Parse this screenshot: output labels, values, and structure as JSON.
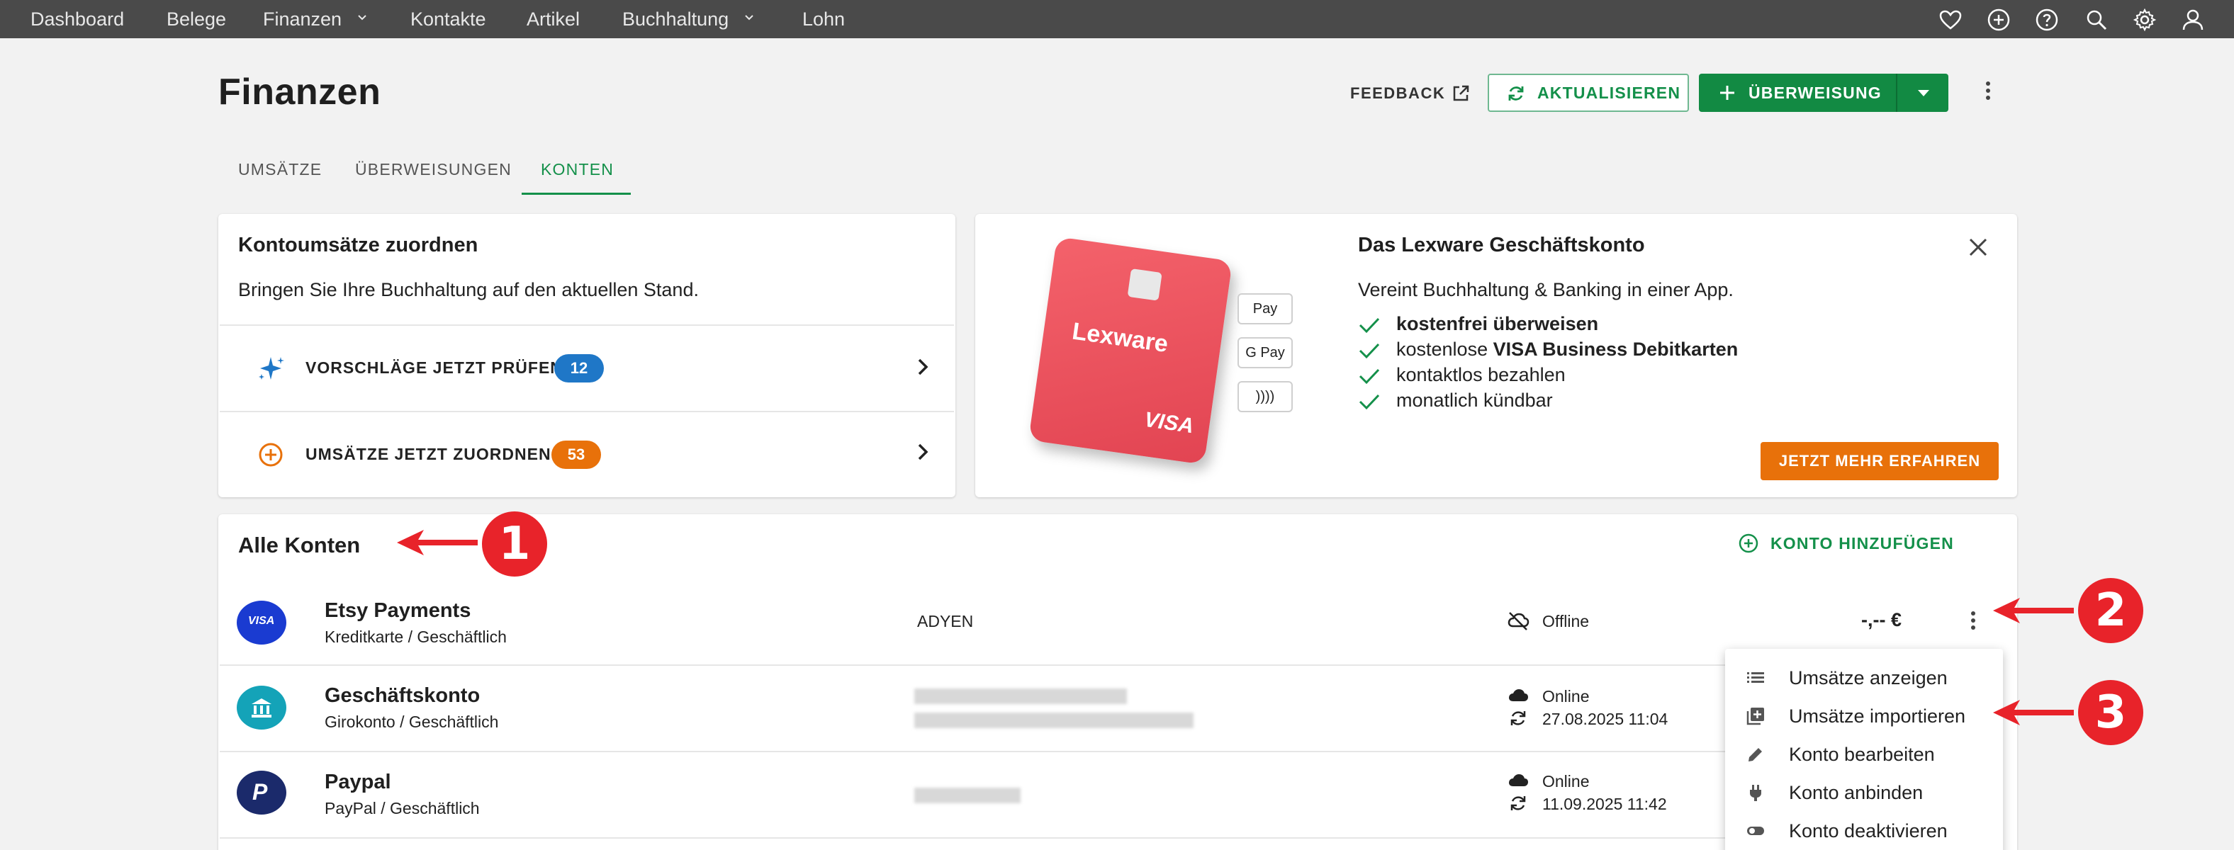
{
  "topnav": {
    "items": [
      "Dashboard",
      "Belege",
      "Finanzen",
      "Kontakte",
      "Artikel",
      "Buchhaltung",
      "Lohn"
    ]
  },
  "header": {
    "title": "Finanzen",
    "feedback_label": "FEEDBACK",
    "refresh_label": "AKTUALISIEREN",
    "transfer_label": "ÜBERWEISUNG"
  },
  "tabs": [
    "UMSÄTZE",
    "ÜBERWEISUNGEN",
    "KONTEN"
  ],
  "assign_card": {
    "title": "Kontoumsätze zuordnen",
    "text": "Bringen Sie Ihre Buchhaltung auf den aktuellen Stand.",
    "actions": [
      {
        "label": "VORSCHLÄGE JETZT PRÜFEN",
        "count": "12",
        "color": "#1f77c7"
      },
      {
        "label": "UMSÄTZE JETZT ZUORDNEN",
        "count": "53",
        "color": "#e8710a"
      }
    ]
  },
  "promo_card": {
    "title": "Das Lexware Geschäftskonto",
    "text": "Vereint Buchhaltung & Banking in einer App.",
    "card_brand": "Lexware",
    "card_network": "VISA",
    "pay_methods": [
      "Pay",
      "G Pay",
      "))))"
    ],
    "features": [
      {
        "pre": "",
        "bold": "kostenfrei überweisen",
        "post": ""
      },
      {
        "pre": "kostenlose ",
        "bold": "VISA Business Debitkarten",
        "post": ""
      },
      {
        "pre": "kontaktlos bezahlen",
        "bold": "",
        "post": ""
      },
      {
        "pre": "monatlich kündbar",
        "bold": "",
        "post": ""
      }
    ],
    "cta_label": "JETZT MEHR ERFAHREN"
  },
  "accounts": {
    "title": "Alle Konten",
    "add_label": "KONTO HINZUFÜGEN",
    "rows": [
      {
        "name": "Etsy Payments",
        "sub": "Kreditkarte / Geschäftlich",
        "bank": "ADYEN",
        "status": "Offline",
        "date": "",
        "amount": "-,-- €",
        "logo": "VISA",
        "logo_color": "#1a3bd1"
      },
      {
        "name": "Geschäftskonto",
        "sub": "Girokonto / Geschäftlich",
        "bank": "",
        "status": "Online",
        "date": "27.08.2025 11:04",
        "amount": "",
        "logo": "bank-icon",
        "logo_color": "#14a3b8"
      },
      {
        "name": "Paypal",
        "sub": "PayPal / Geschäftlich",
        "bank": "",
        "status": "Online",
        "date": "11.09.2025 11:42",
        "amount": "",
        "logo": "paypal-icon",
        "logo_color": "#1b2a6b"
      }
    ]
  },
  "menu": {
    "items": [
      "Umsätze anzeigen",
      "Umsätze importieren",
      "Konto bearbeiten",
      "Konto anbinden",
      "Konto deaktivieren"
    ]
  },
  "annotations": [
    "1",
    "2",
    "3"
  ],
  "colors": {
    "accent": "#14904a",
    "orange": "#e8710a",
    "annotation": "#e8232a"
  }
}
